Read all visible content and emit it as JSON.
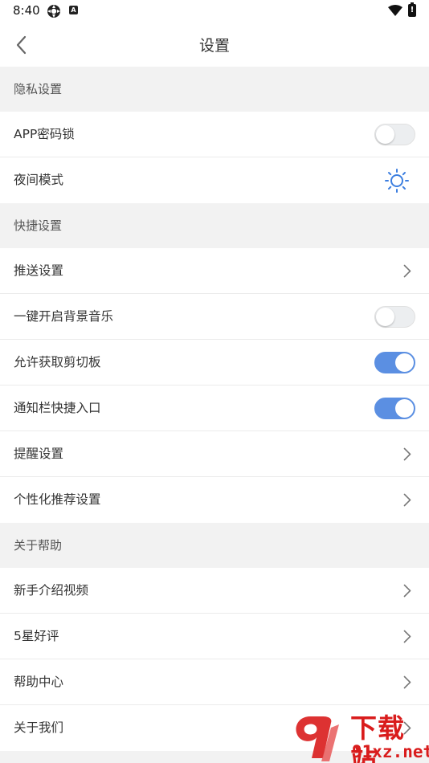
{
  "status_bar": {
    "time": "8:40",
    "battery_glyph": "!",
    "a_glyph": "A"
  },
  "header": {
    "title": "设置",
    "back_icon": "chevron-left-icon"
  },
  "sections": [
    {
      "header": "隐私设置",
      "rows": [
        {
          "label": "APP密码锁",
          "control": "toggle",
          "on": false
        },
        {
          "label": "夜间模式",
          "control": "sun-icon"
        }
      ]
    },
    {
      "header": "快捷设置",
      "rows": [
        {
          "label": "推送设置",
          "control": "chevron"
        },
        {
          "label": "一键开启背景音乐",
          "control": "toggle",
          "on": false
        },
        {
          "label": "允许获取剪切板",
          "control": "toggle",
          "on": true
        },
        {
          "label": "通知栏快捷入口",
          "control": "toggle",
          "on": true
        },
        {
          "label": "提醒设置",
          "control": "chevron"
        },
        {
          "label": "个性化推荐设置",
          "control": "chevron"
        }
      ]
    },
    {
      "header": "关于帮助",
      "rows": [
        {
          "label": "新手介绍视频",
          "control": "chevron"
        },
        {
          "label": "5星好评",
          "control": "chevron"
        },
        {
          "label": "帮助中心",
          "control": "chevron"
        },
        {
          "label": "关于我们",
          "control": "chevron"
        }
      ]
    }
  ],
  "colors": {
    "toggle_on": "#5b8fe2",
    "section_bg": "#f2f2f2",
    "sun_icon": "#3d7fe0"
  },
  "watermark": {
    "line1": "下载站",
    "line2": "91xz.net"
  }
}
